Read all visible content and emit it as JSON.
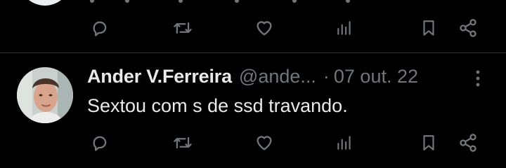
{
  "tweet": {
    "author_name": "Ander V.Ferreira",
    "handle": "@ande...",
    "separator": "·",
    "date": "07 out. 22",
    "text": "Sextou com s de ssd travando."
  },
  "icons": {
    "reply": "speech-bubble-icon",
    "retweet": "retweet-arrows-icon",
    "like": "heart-icon",
    "views": "bar-chart-icon",
    "bookmark": "bookmark-icon",
    "share": "share-nodes-icon",
    "more": "vertical-dots-icon"
  },
  "colors": {
    "background": "#000000",
    "primary_text": "#e7e9ea",
    "secondary_text": "#71767b",
    "divider": "#2f3336"
  }
}
